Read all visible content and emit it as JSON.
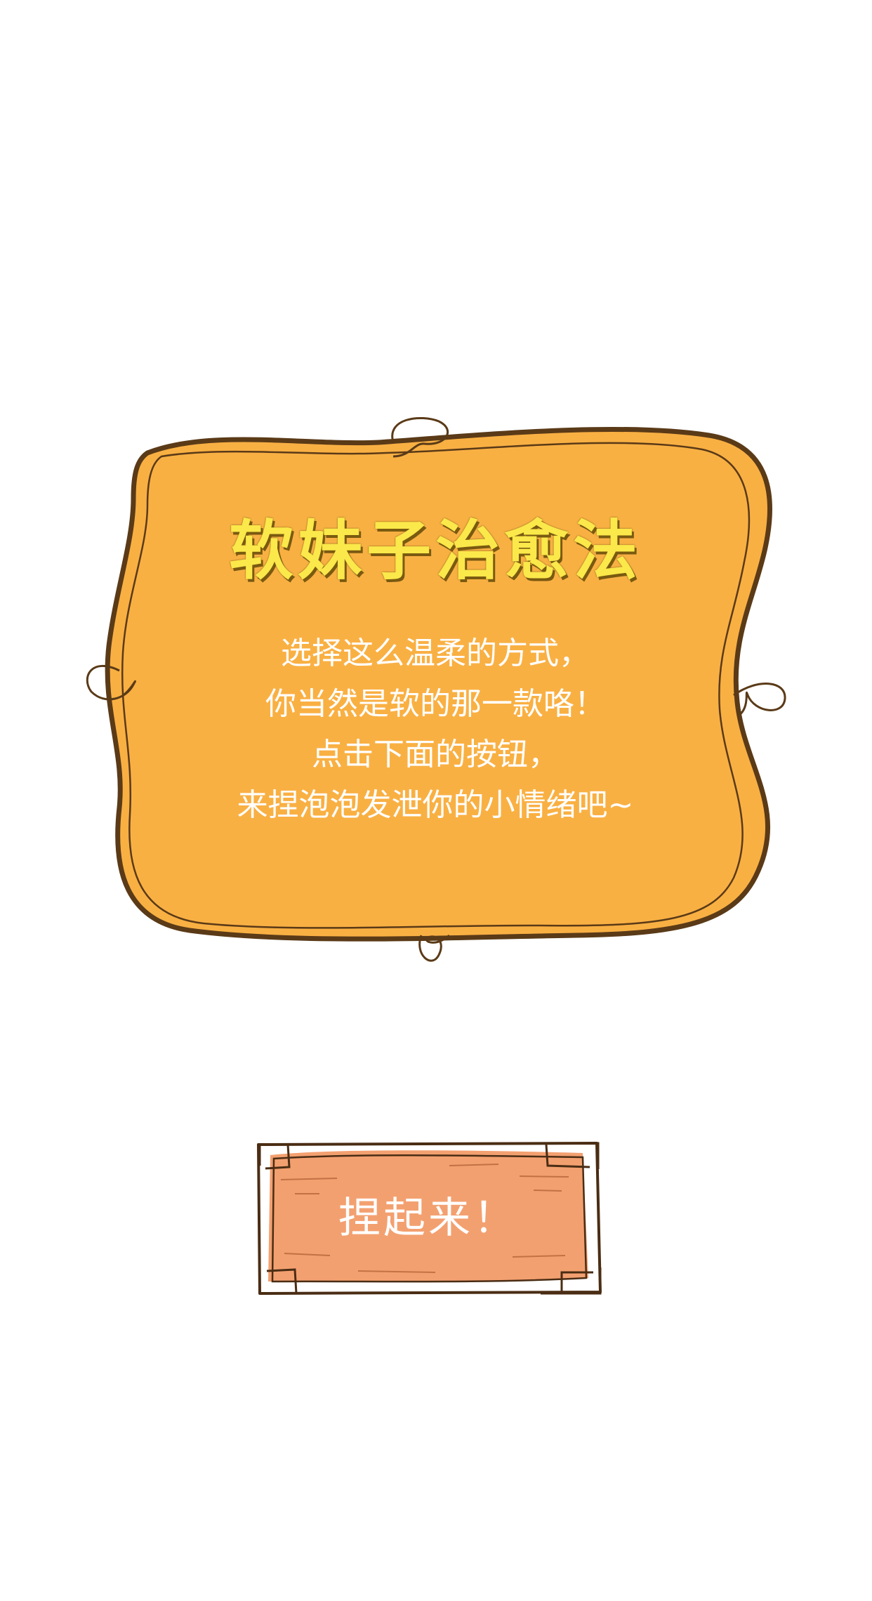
{
  "card": {
    "title": "软妹子治愈法",
    "lines": [
      "选择这么温柔的方式，",
      "你当然是软的那一款咯！",
      "点击下面的按钮，",
      "来捏泡泡发泄你的小情绪吧~"
    ],
    "fill_color": "#f9b043",
    "outline_color": "#5a3a17"
  },
  "action_button": {
    "label": "捏起来！",
    "fill_color": "#f3a070",
    "outline_color": "#4a2d14"
  }
}
